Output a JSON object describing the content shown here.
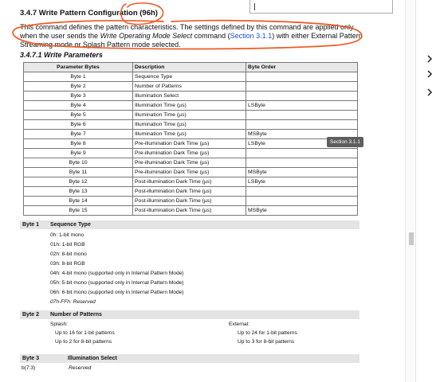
{
  "doc": {
    "section_title": "3.4.7 Write Pattern Configuration (96h)",
    "para": {
      "part1": "This command defines the pattern characteristics. The settings defined by this command are applied only when the user sends the ",
      "cmd": "Write Operating Mode Select",
      "part2": " command (",
      "link": "Section 3.1.1",
      "part3": ") with either External Pattern Streaming mode or Splash Pattern mode selected."
    },
    "subsection_title": "3.4.7.1 Write Parameters",
    "table": {
      "headers": [
        "Parameter Bytes",
        "Description",
        "Byte Order"
      ],
      "rows": [
        [
          "Byte 1",
          "Sequence Type",
          ""
        ],
        [
          "Byte 2",
          "Number of Patterns",
          ""
        ],
        [
          "Byte 3",
          "Illumination Select",
          ""
        ],
        [
          "Byte 4",
          "Illumination Time (µs)",
          "LSByte"
        ],
        [
          "Byte 5",
          "Illumination Time (µs)",
          ""
        ],
        [
          "Byte 6",
          "Illumination Time (µs)",
          ""
        ],
        [
          "Byte 7",
          "Illumination Time (µs)",
          "MSByte"
        ],
        [
          "Byte 8",
          "Pre-illumination Dark Time (µs)",
          "LSByte"
        ],
        [
          "Byte 9",
          "Pre-illumination Dark Time (µs)",
          ""
        ],
        [
          "Byte 10",
          "Pre-illumination Dark Time (µs)",
          ""
        ],
        [
          "Byte 11",
          "Pre-illumination Dark Time (µs)",
          "MSByte"
        ],
        [
          "Byte 12",
          "Post-illumination Dark Time (µs)",
          "LSByte"
        ],
        [
          "Byte 13",
          "Post-illumination Dark Time (µs)",
          ""
        ],
        [
          "Byte 14",
          "Post-illumination Dark Time (µs)",
          ""
        ],
        [
          "Byte 15",
          "Post-illumination Dark Time (µs)",
          "MSByte"
        ]
      ]
    },
    "tooltip": "Section 3.1.1",
    "byte1": {
      "label": "Byte 1",
      "title": "Sequence Type",
      "items": [
        "0h: 1-bit mono",
        "01h: 1-bit RGB",
        "02h: 8-bit mono",
        "03h: 8-bit RGB",
        "04h: 4-bit mono (supported only in Internal Pattern Mode)",
        "05h: 5-bit mono (supported only in Internal Pattern Mode)",
        "06h: 6-bit mono (supported only in Internal Pattern Mode)",
        "07h-FFh: Reserved"
      ]
    },
    "byte2": {
      "label": "Byte 2",
      "title": "Number of Patterns",
      "splash_label": "Splash:",
      "splash_items": [
        "Up to 16 for 1-bit patterns",
        "Up to 2 for 8-bit patterns"
      ],
      "external_label": "External:",
      "external_items": [
        "Up to 24 for 1-bit patterns",
        "Up to 3 for 8-bit patterns"
      ]
    },
    "byte3": {
      "label": "Byte 3",
      "title": "Illumination Select",
      "bit_label": "b(7:3)",
      "bit_value": "Reserved"
    }
  },
  "colors": {
    "annotation": "#ee5a24",
    "link": "#1a4fd0",
    "section_bar": "#e4e4e4",
    "tooltip_bg": "#5e5e5e"
  },
  "icons": [
    "chevron-right-icon",
    "chevron-right-icon",
    "chevron-right-icon"
  ]
}
